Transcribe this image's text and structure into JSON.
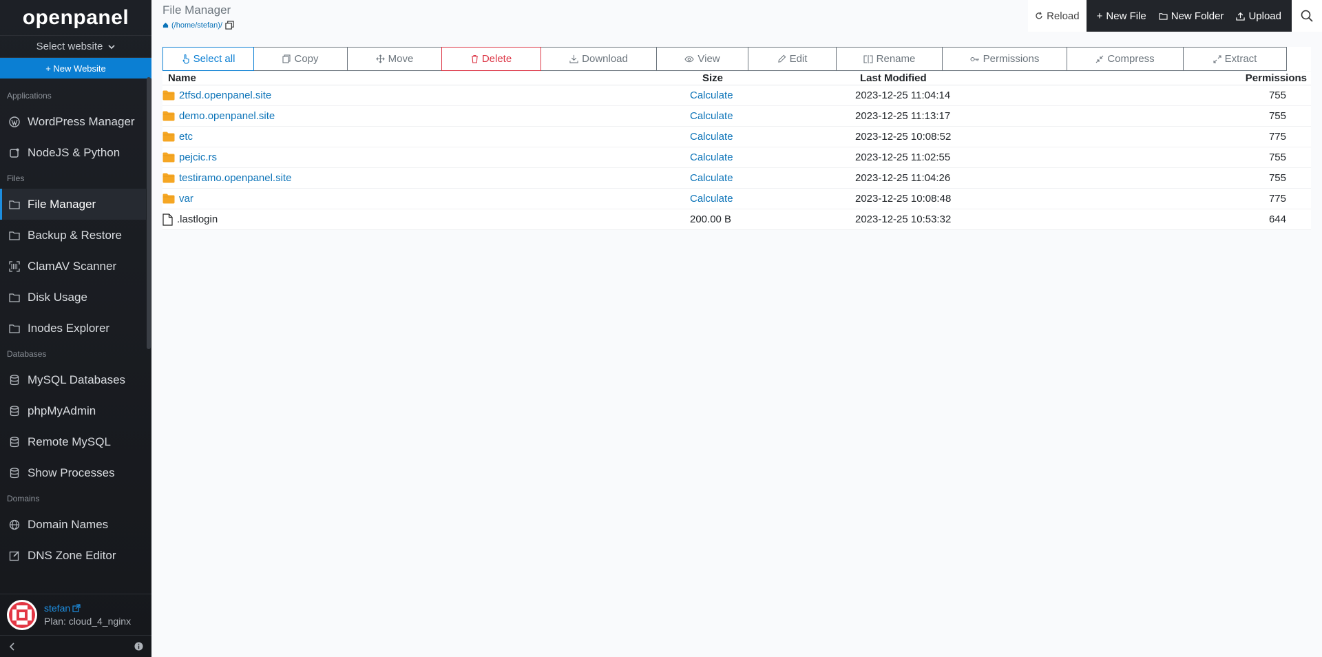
{
  "brand": "openpanel",
  "sidebar": {
    "select_website": "Select website",
    "new_website": "+ New Website",
    "sections": [
      {
        "title": "Applications",
        "items": [
          {
            "label": "WordPress Manager",
            "icon": "wordpress-icon"
          },
          {
            "label": "NodeJS & Python",
            "icon": "nodejs-icon"
          }
        ]
      },
      {
        "title": "Files",
        "items": [
          {
            "label": "File Manager",
            "icon": "folder-icon",
            "active": true
          },
          {
            "label": "Backup & Restore",
            "icon": "folder-icon"
          },
          {
            "label": "ClamAV Scanner",
            "icon": "scanner-icon"
          },
          {
            "label": "Disk Usage",
            "icon": "folder-icon"
          },
          {
            "label": "Inodes Explorer",
            "icon": "folder-icon"
          }
        ]
      },
      {
        "title": "Databases",
        "items": [
          {
            "label": "MySQL Databases",
            "icon": "database-icon"
          },
          {
            "label": "phpMyAdmin",
            "icon": "database-icon"
          },
          {
            "label": "Remote MySQL",
            "icon": "database-icon"
          },
          {
            "label": "Show Processes",
            "icon": "database-icon"
          }
        ]
      },
      {
        "title": "Domains",
        "items": [
          {
            "label": "Domain Names",
            "icon": "globe-icon"
          },
          {
            "label": "DNS Zone Editor",
            "icon": "edit-icon"
          }
        ]
      }
    ],
    "user": {
      "name": "stefan",
      "plan": "Plan: cloud_4_nginx"
    }
  },
  "header": {
    "title": "File Manager",
    "path": "(/home/stefan)/",
    "reload": "Reload",
    "new_file": "New File",
    "new_folder": "New Folder",
    "upload": "Upload"
  },
  "toolbar": [
    {
      "label": "Select all",
      "icon": "pointer-icon",
      "style": "primary",
      "width": 133
    },
    {
      "label": "Copy",
      "icon": "copy-icon",
      "style": "",
      "width": 137
    },
    {
      "label": "Move",
      "icon": "move-icon",
      "style": "",
      "width": 138
    },
    {
      "label": "Delete",
      "icon": "trash-icon",
      "style": "danger",
      "width": 145
    },
    {
      "label": "Download",
      "icon": "download-icon",
      "style": "",
      "width": 169
    },
    {
      "label": "View",
      "icon": "eye-icon",
      "style": "",
      "width": 134
    },
    {
      "label": "Edit",
      "icon": "pencil-icon",
      "style": "",
      "width": 129
    },
    {
      "label": "Rename",
      "icon": "rename-icon",
      "style": "",
      "width": 155
    },
    {
      "label": "Permissions",
      "icon": "key-icon",
      "style": "",
      "width": 182
    },
    {
      "label": "Compress",
      "icon": "compress-icon",
      "style": "",
      "width": 170
    },
    {
      "label": "Extract",
      "icon": "expand-icon",
      "style": "",
      "width": 151
    }
  ],
  "table": {
    "columns": [
      "Name",
      "Size",
      "Last Modified",
      "Permissions"
    ],
    "rows": [
      {
        "name": "2tfsd.openpanel.site",
        "type": "folder",
        "size": "Calculate",
        "modified": "2023-12-25 11:04:14",
        "perm": "755"
      },
      {
        "name": "demo.openpanel.site",
        "type": "folder",
        "size": "Calculate",
        "modified": "2023-12-25 11:13:17",
        "perm": "755"
      },
      {
        "name": "etc",
        "type": "folder",
        "size": "Calculate",
        "modified": "2023-12-25 10:08:52",
        "perm": "775"
      },
      {
        "name": "pejcic.rs",
        "type": "folder",
        "size": "Calculate",
        "modified": "2023-12-25 11:02:55",
        "perm": "755"
      },
      {
        "name": "testiramo.openpanel.site",
        "type": "folder",
        "size": "Calculate",
        "modified": "2023-12-25 11:04:26",
        "perm": "755"
      },
      {
        "name": "var",
        "type": "folder",
        "size": "Calculate",
        "modified": "2023-12-25 10:08:48",
        "perm": "775"
      },
      {
        "name": ".lastlogin",
        "type": "file",
        "size": "200.00 B",
        "modified": "2023-12-25 10:53:32",
        "perm": "644"
      }
    ]
  },
  "colors": {
    "accent": "#0b7fd3",
    "danger": "#dc3545",
    "folder": "#f5a623",
    "sidebar": "#1b1e23"
  }
}
